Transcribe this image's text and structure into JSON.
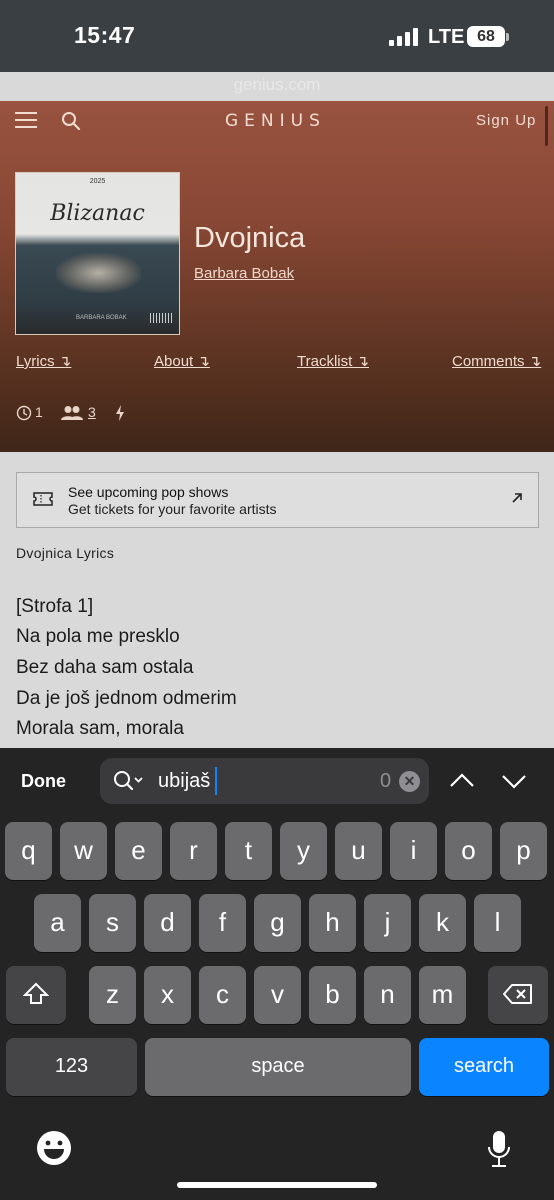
{
  "status": {
    "time": "15:47",
    "network": "LTE",
    "battery": "68"
  },
  "browser": {
    "url": "genius.com"
  },
  "header": {
    "logo": "GENIUS",
    "sign_up": "Sign Up"
  },
  "cover": {
    "year": "2025",
    "title": "Blizanac",
    "artist": "BARBARA BOBAK"
  },
  "song": {
    "title": "Dvojnica",
    "artist": "Barbara Bobak"
  },
  "nav": [
    "Lyrics ↴",
    "About ↴",
    "Tracklist ↴",
    "Comments ↴"
  ],
  "stats": {
    "versions": "1",
    "contributors": "3"
  },
  "promo": {
    "title": "See upcoming pop shows",
    "subtitle": "Get tickets for your favorite artists"
  },
  "lyrics": {
    "heading": "Dvojnica Lyrics",
    "lines": [
      "[Strofa 1]",
      "Na pola me presklo",
      "Bez daha sam ostala",
      "Da je još jednom odmerim",
      "Morala sam, morala"
    ]
  },
  "find_bar": {
    "done": "Done",
    "query": "ubijaš",
    "count": "0"
  },
  "keyboard": {
    "row1": [
      "q",
      "w",
      "e",
      "r",
      "t",
      "y",
      "u",
      "i",
      "o",
      "p"
    ],
    "row2": [
      "a",
      "s",
      "d",
      "f",
      "g",
      "h",
      "j",
      "k",
      "l"
    ],
    "row3": [
      "z",
      "x",
      "c",
      "v",
      "b",
      "n",
      "m"
    ],
    "numbers": "123",
    "space": "space",
    "search": "search"
  }
}
